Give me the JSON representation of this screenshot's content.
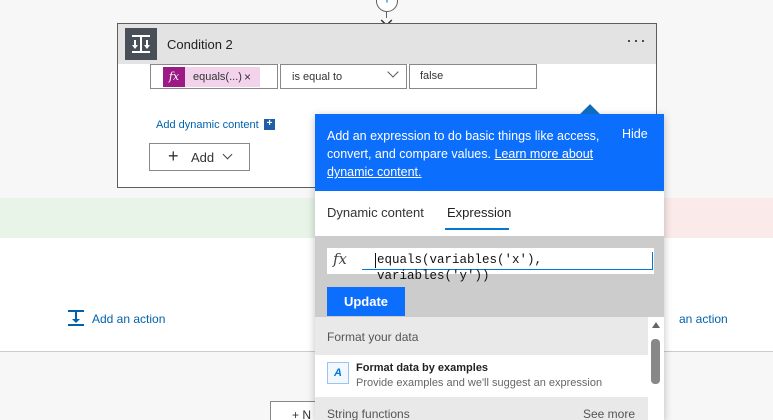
{
  "top_connector": {
    "glyph": "+"
  },
  "condition": {
    "title": "Condition 2",
    "more": "···",
    "token_fx": "fx",
    "token_label": "equals(...)",
    "token_remove": "×",
    "operator": "is equal to",
    "value": "false",
    "add_dynamic": "Add dynamic content",
    "add_dynamic_plus": "+",
    "add_button": "Add",
    "add_plus": "+"
  },
  "branches": {
    "left_action": "Add an action",
    "right_action": "an action",
    "new_step": "+ N"
  },
  "popup": {
    "head_text_pre": "Add an expression to do basic things like access, convert, and compare values.",
    "learn_more": "Learn more about dynamic content.",
    "hide": "Hide",
    "tab_dynamic": "Dynamic content",
    "tab_expression": "Expression",
    "fx": "fx",
    "expression": "equals(variables('x'), variables('y'))",
    "update": "Update",
    "section_format": "Format your data",
    "format_title": "Format data by examples",
    "format_sub": "Provide examples and we'll suggest an expression",
    "section_string": "String functions",
    "see_more": "See more"
  },
  "colors": {
    "accent": "#0c6efc",
    "token_fx_bg": "#9c1a86",
    "token_bg": "#f3d3ec",
    "yes_band": "#e8f4e8",
    "no_band": "#fbeaea"
  },
  "icons": [
    "condition-icon",
    "more-options-icon",
    "chevron-down-icon",
    "add-action-icon",
    "format-data-icon",
    "scroll-up-icon"
  ]
}
